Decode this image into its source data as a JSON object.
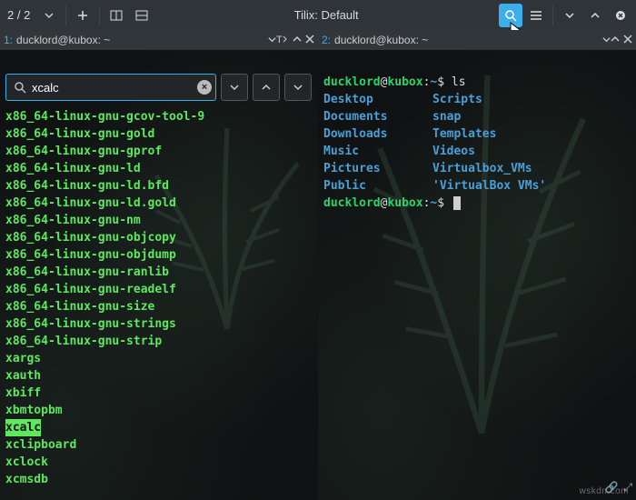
{
  "titlebar": {
    "session_count": "2 / 2",
    "title": "Tilix: Default"
  },
  "panes": {
    "left": {
      "num": "1:",
      "title": "ducklord@kubox: ~",
      "search": {
        "query": "xcalc",
        "placeholder": "Search"
      },
      "results": [
        "x86_64-linux-gnu-gcov-tool-9",
        "x86_64-linux-gnu-gold",
        "x86_64-linux-gnu-gprof",
        "x86_64-linux-gnu-ld",
        "x86_64-linux-gnu-ld.bfd",
        "x86_64-linux-gnu-ld.gold",
        "x86_64-linux-gnu-nm",
        "x86_64-linux-gnu-objcopy",
        "x86_64-linux-gnu-objdump",
        "x86_64-linux-gnu-ranlib",
        "x86_64-linux-gnu-readelf",
        "x86_64-linux-gnu-size",
        "x86_64-linux-gnu-strings",
        "x86_64-linux-gnu-strip",
        "xargs",
        "xauth",
        "xbiff",
        "xbmtopbm",
        "xcalc",
        "xclipboard",
        "xclock",
        "xcmsdb"
      ],
      "highlighted_index": 18
    },
    "right": {
      "num": "2:",
      "title": "ducklord@kubox: ~",
      "prompt": {
        "user": "ducklord",
        "host": "kubox",
        "path": "~",
        "symbol": "$"
      },
      "command": "ls",
      "listing": [
        [
          "Desktop",
          "Scripts"
        ],
        [
          "Documents",
          "snap"
        ],
        [
          "Downloads",
          "Templates"
        ],
        [
          "Music",
          "Videos"
        ],
        [
          "Pictures",
          "Virtualbox_VMs"
        ],
        [
          "Public",
          "'VirtualBox VMs'"
        ]
      ]
    }
  },
  "watermark": "wskdn.com"
}
